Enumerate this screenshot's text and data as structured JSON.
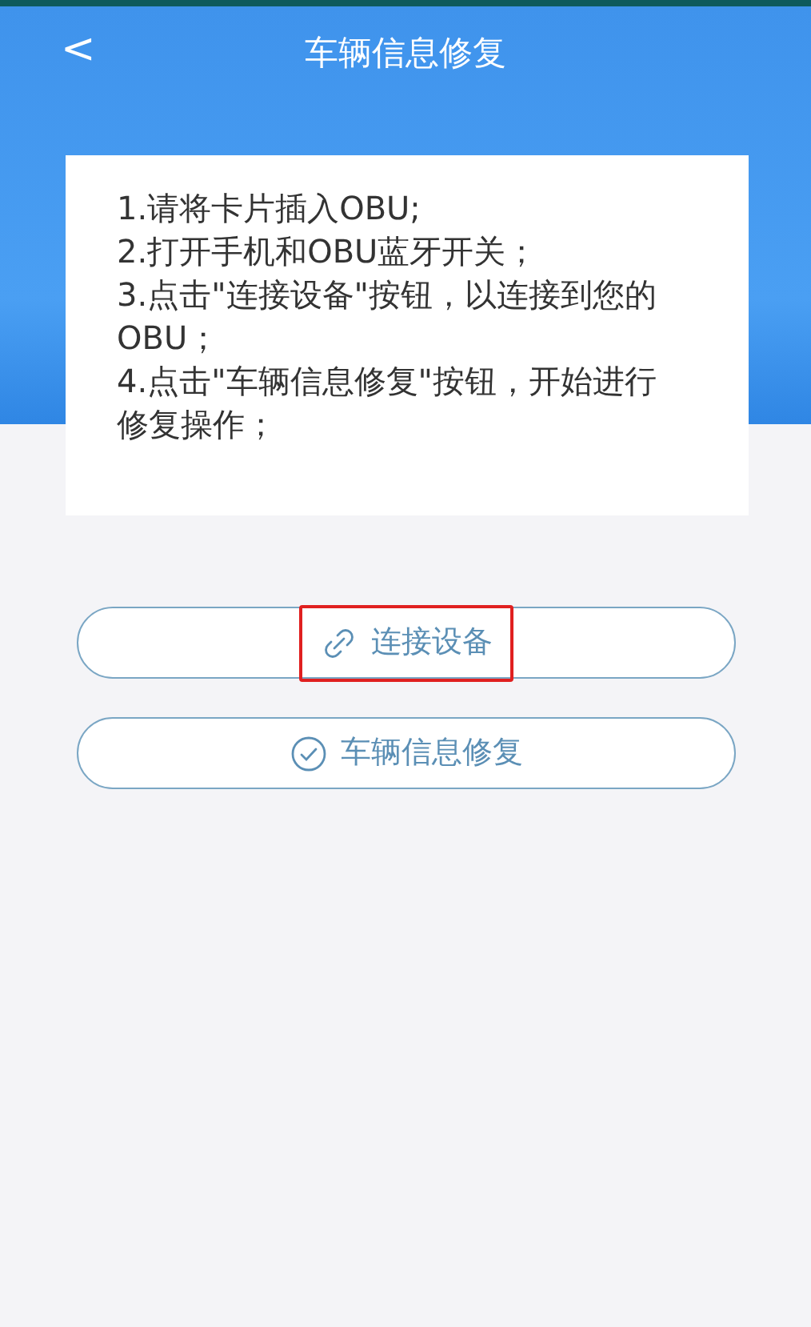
{
  "header": {
    "back": "<",
    "title": "车辆信息修复"
  },
  "instructions": [
    "1.请将卡片插入OBU;",
    "2.打开手机和OBU蓝牙开关；",
    "3.点击\"连接设备\"按钮，以连接到您的OBU；",
    "4.点击\"车辆信息修复\"按钮，开始进行修复操作；"
  ],
  "buttons": [
    {
      "label": "连接设备",
      "kind": "link",
      "highlighted": true
    },
    {
      "label": "车辆信息修复",
      "kind": "check",
      "highlighted": false
    }
  ]
}
